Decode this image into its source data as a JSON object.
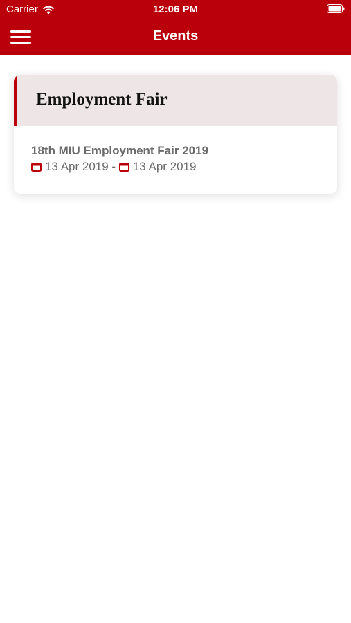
{
  "status_bar": {
    "carrier": "Carrier",
    "time": "12:06 PM"
  },
  "nav": {
    "title": "Events",
    "menu_icon": "hamburger-menu-icon"
  },
  "section": {
    "title": "Employment Fair"
  },
  "events": [
    {
      "name": "18th MIU Employment Fair 2019",
      "start_date": "13 Apr 2019",
      "separator": " - ",
      "end_date": "13 Apr 2019",
      "date_icon": "calendar-icon"
    }
  ],
  "colors": {
    "brand": "#b9000b",
    "header_bg": "#eee6e6",
    "text_gray": "#6b6b6b"
  }
}
